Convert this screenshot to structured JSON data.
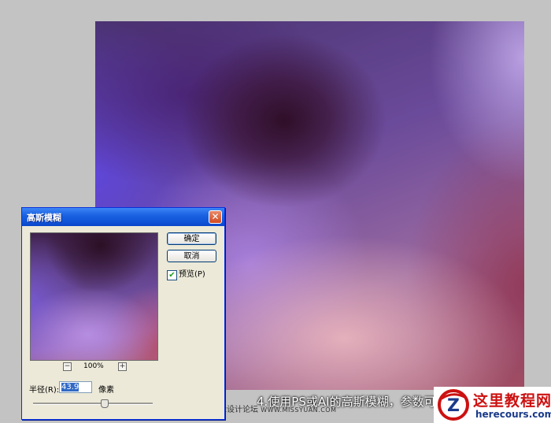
{
  "caption": "4.使用PS或AI的高斯模糊，参数可以根",
  "watermark": {
    "cn": "思缘设计论坛",
    "url": "WWW.MISSYUAN.COM"
  },
  "dialog": {
    "title": "高斯模糊",
    "close_label": "✕",
    "ok_label": "确定",
    "cancel_label": "取消",
    "preview_checked": true,
    "preview_check_mark": "✔",
    "preview_label": "预览(P)",
    "zoom_minus": "−",
    "zoom_plus": "+",
    "zoom_level": "100%",
    "radius_label": "半径(R):",
    "radius_value": "43.9",
    "radius_unit": "像素"
  },
  "logo": {
    "letter": "Z",
    "name": "这里教程网",
    "url": "herecours.com"
  },
  "colors": {
    "canvas_bg": "#c3c3c3",
    "title_bar": "#0f52d6",
    "logo_red": "#cc1111",
    "logo_blue": "#1a3a8a"
  }
}
